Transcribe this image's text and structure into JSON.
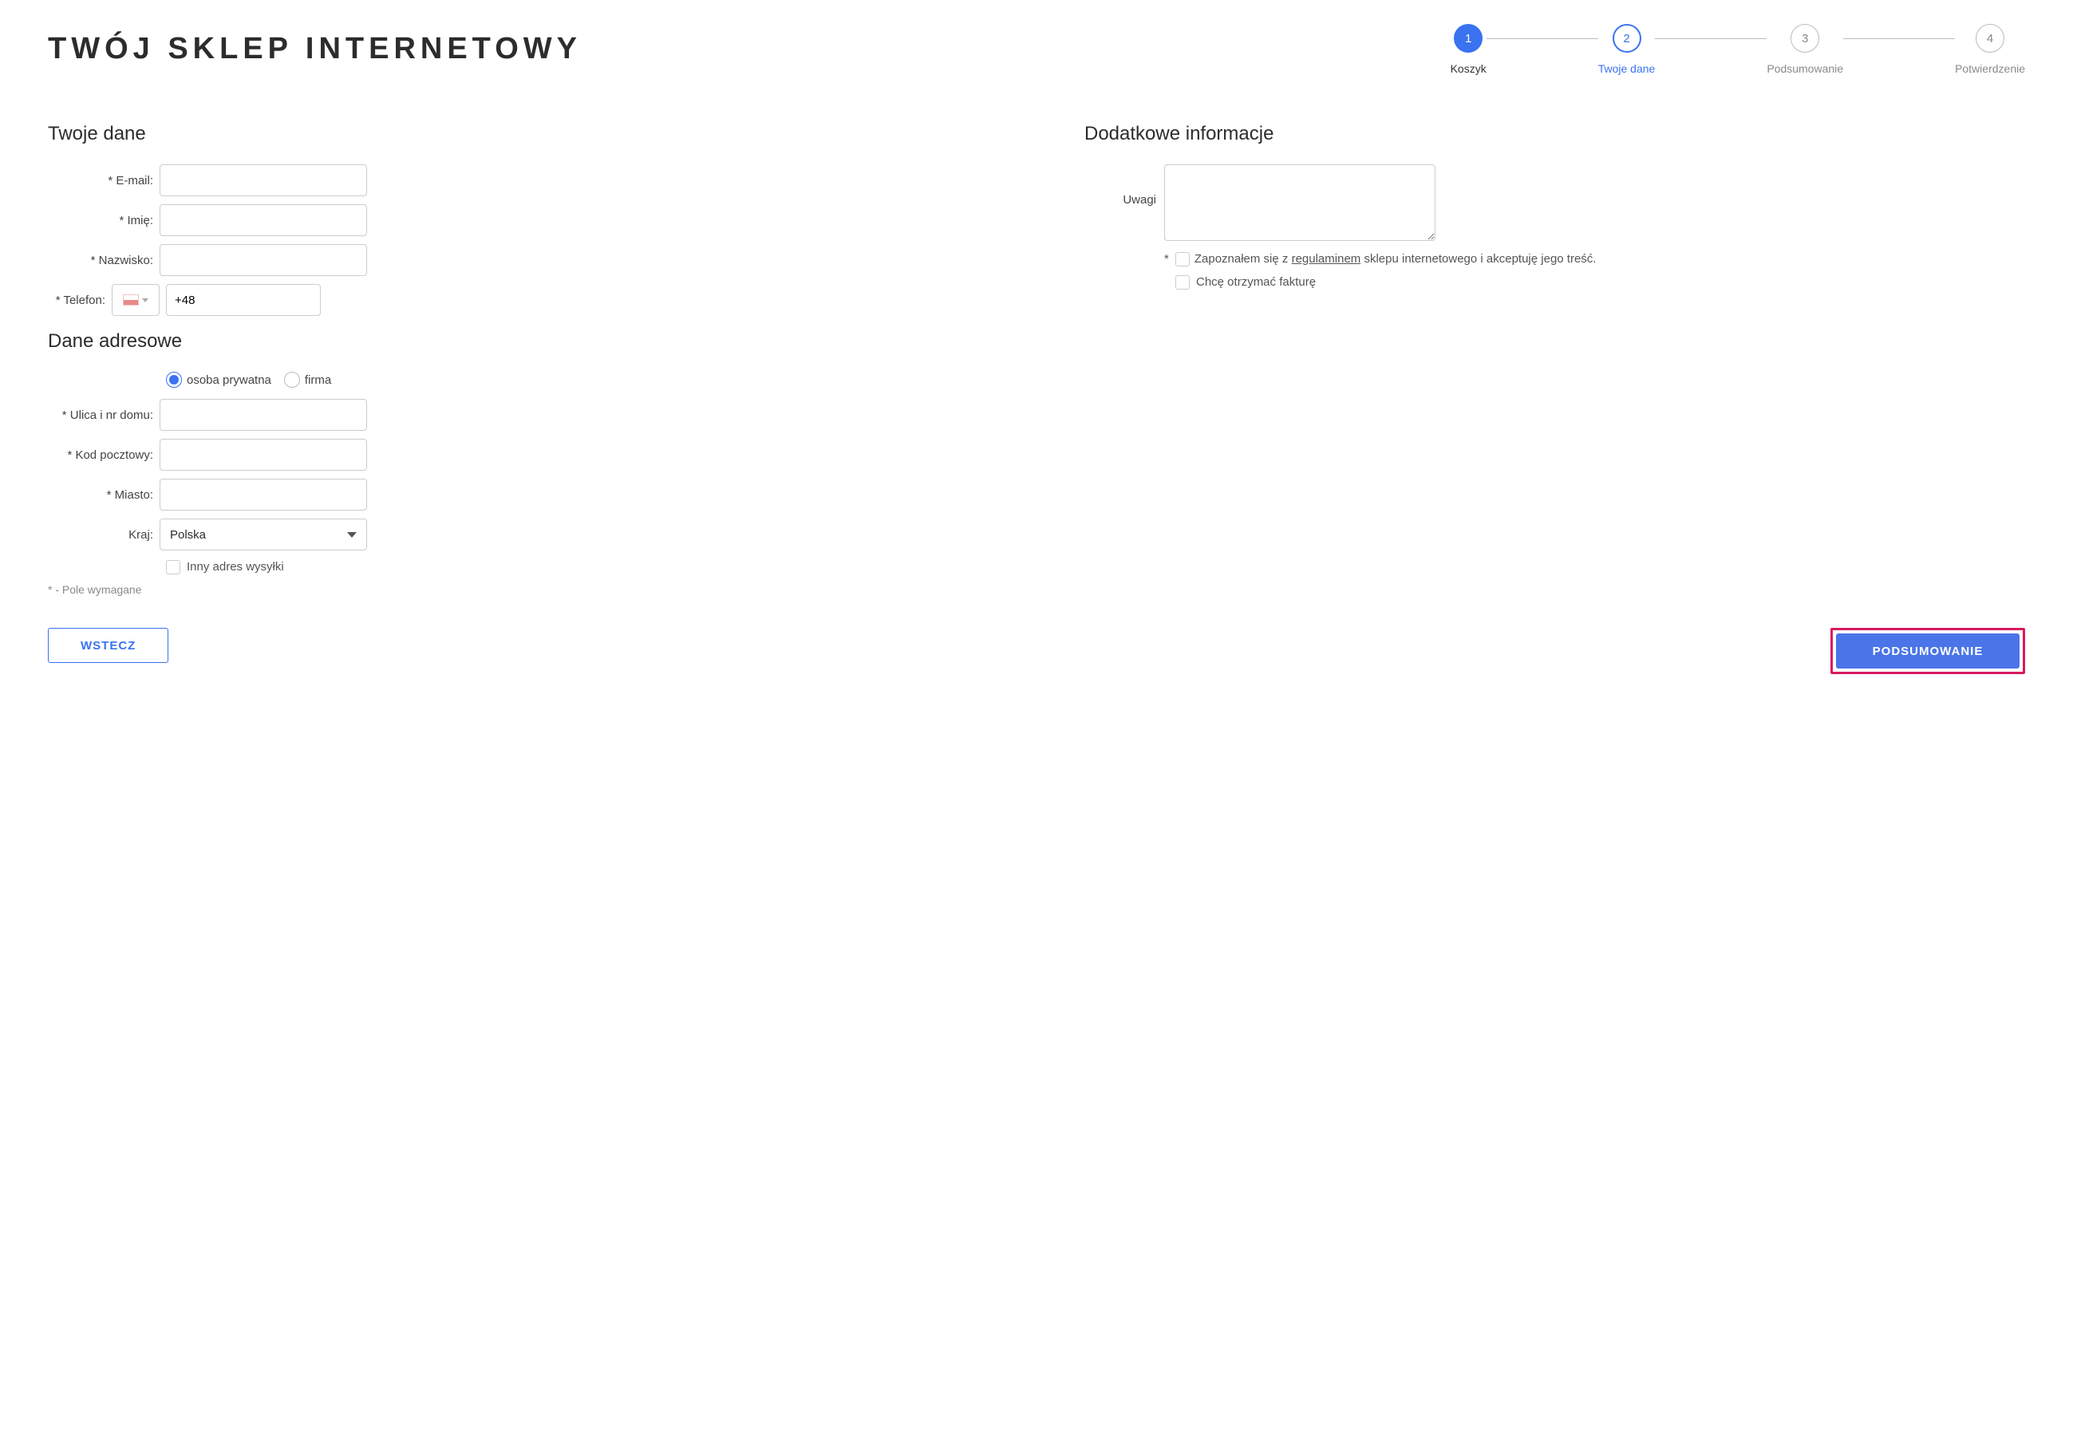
{
  "page_title": "TWÓJ SKLEP INTERNETOWY",
  "stepper": {
    "steps": [
      {
        "num": "1",
        "label": "Koszyk"
      },
      {
        "num": "2",
        "label": "Twoje dane"
      },
      {
        "num": "3",
        "label": "Podsumowanie"
      },
      {
        "num": "4",
        "label": "Potwierdzenie"
      }
    ]
  },
  "personal": {
    "heading": "Twoje dane",
    "email_label": "* E-mail:",
    "firstname_label": "* Imię:",
    "lastname_label": "* Nazwisko:",
    "phone_label": "* Telefon:",
    "phone_value": "+48"
  },
  "address": {
    "heading": "Dane adresowe",
    "type_private": "osoba prywatna",
    "type_company": "firma",
    "street_label": "* Ulica i nr domu:",
    "zip_label": "* Kod pocztowy:",
    "city_label": "* Miasto:",
    "country_label": "Kraj:",
    "country_value": "Polska",
    "different_shipping": "Inny adres wysyłki"
  },
  "required_note": "* - Pole wymagane",
  "additional": {
    "heading": "Dodatkowe informacje",
    "notes_label": "Uwagi",
    "terms_asterisk": "*",
    "terms_prefix": "Zapoznałem się z ",
    "terms_link": "regulaminem",
    "terms_suffix": " sklepu internetowego i akceptuję jego treść.",
    "invoice_label": "Chcę otrzymać fakturę"
  },
  "buttons": {
    "back": "WSTECZ",
    "next": "PODSUMOWANIE"
  }
}
